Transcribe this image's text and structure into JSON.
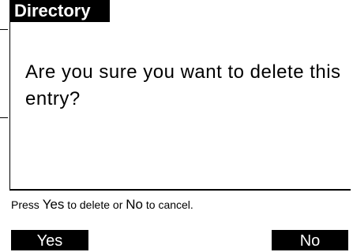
{
  "header": {
    "title": "Directory"
  },
  "dialog": {
    "message": "Are you sure you want to delete this entry?"
  },
  "hint": {
    "prefix": "Press ",
    "yes_key": "Yes",
    "middle": " to delete or ",
    "no_key": "No",
    "suffix": " to cancel."
  },
  "softkeys": {
    "yes": "Yes",
    "no": "No"
  }
}
